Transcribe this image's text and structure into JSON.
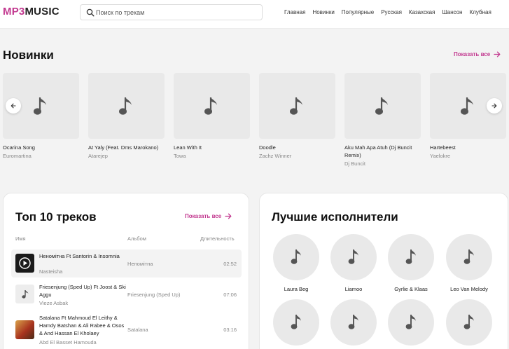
{
  "header": {
    "logo_a": "MP3",
    "logo_b": "MUSIC",
    "search_placeholder": "Поиск по трекам",
    "nav": [
      "Главная",
      "Новинки",
      "Популярные",
      "Русская",
      "Казахская",
      "Шансон",
      "Клубная"
    ]
  },
  "new_section": {
    "title": "Новинки",
    "show_all": "Показать все",
    "cards": [
      {
        "title": "Ocarina Song",
        "artist": "Euromartina"
      },
      {
        "title": "At Yaly (Feat. Dms Marokano)",
        "artist": "Atarejep"
      },
      {
        "title": "Lean With It",
        "artist": "Towa"
      },
      {
        "title": "Doodle",
        "artist": "Zachz Winner"
      },
      {
        "title": "Aku Mah Apa Atuh (Dj Buncit Remix)",
        "artist": "Dj Buncit"
      },
      {
        "title": "Hartebeest",
        "artist": "Yaelokre"
      }
    ]
  },
  "top_tracks": {
    "title": "Топ 10 треков",
    "show_all": "Показать все",
    "columns": {
      "name": "Имя",
      "album": "Альбом",
      "duration": "Длительность"
    },
    "rows": [
      {
        "title": "Неномітна Ft Santorin & Insomnia",
        "artist": "Nasteisha",
        "album": "Непомітна",
        "duration": "02:52"
      },
      {
        "title": "Friesenjung (Sped Up) Ft Joost & Ski Aggu",
        "artist": "Vieze Asbak",
        "album": "Friesenjung (Sped Up)",
        "duration": "07:06"
      },
      {
        "title": "Satalana Ft Mahmoud El Leithy & Hamdy Batshan & Ali Rabee & Osos & And Hassan El Kholaey",
        "artist": "Abd El Basset Hamouda",
        "album": "Satalana",
        "duration": "03:16"
      }
    ]
  },
  "best_artists": {
    "title": "Лучшие исполнители",
    "artists": [
      "Laura Beg",
      "Liamoo",
      "Gyrlie & Klaas",
      "Leo Van Melody",
      "",
      "",
      "",
      ""
    ]
  },
  "colors": {
    "accent": "#c2388f",
    "placeholder_bg": "#e9e9e9",
    "note": "#555555"
  }
}
